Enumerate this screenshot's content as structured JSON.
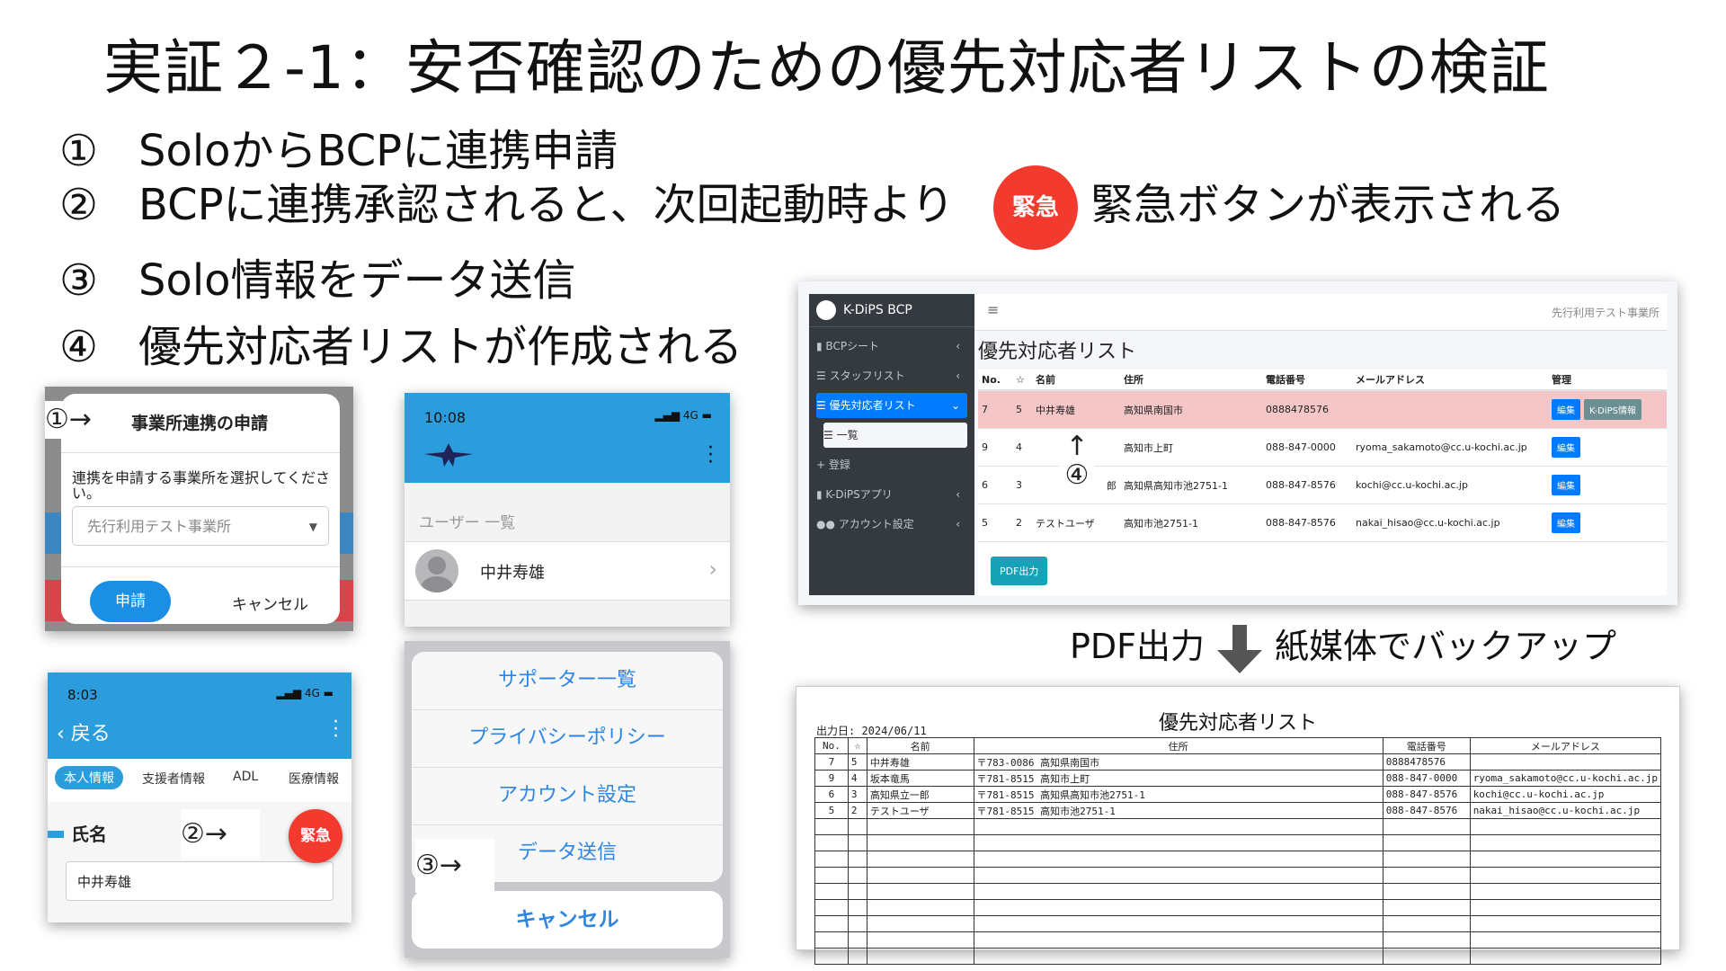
{
  "title": "実証２-1：安否確認のための優先対応者リストの検証",
  "steps": [
    {
      "num": "①",
      "text": "SoloからBCPに連携申請"
    },
    {
      "num": "②",
      "text": "BCPに連携承認されると、次回起動時より",
      "badge": "緊急",
      "after": "緊急ボタンが表示される"
    },
    {
      "num": "③",
      "text": "Solo情報をデータ送信"
    },
    {
      "num": "④",
      "text": "優先対応者リストが作成される"
    }
  ],
  "panel1": {
    "tag": "①→",
    "header": "事業所連携の申請",
    "message": "連携を申請する事業所を選択してください。",
    "select_value": "先行利用テスト事業所",
    "apply": "申請",
    "cancel": "キャンセル"
  },
  "panel2": {
    "time": "10:08",
    "signal": "4G",
    "section": "ユーザー 一覧",
    "user": "中井寿雄"
  },
  "panel3": {
    "time": "8:03",
    "signal": "4G",
    "back": "戻る",
    "tabs": [
      "本人情報",
      "支援者情報",
      "ADL",
      "医療情報"
    ],
    "field_label": "氏名",
    "field_value": "中井寿雄",
    "emergency": "緊急",
    "tag": "②→"
  },
  "panel4": {
    "options": [
      "サポーター一覧",
      "プライバシーポリシー",
      "アカウント設定",
      "データ送信"
    ],
    "cancel": "キャンセル",
    "tag": "③→"
  },
  "webapp": {
    "brand": "K-DiPS BCP",
    "org": "先行利用テスト事業所",
    "menu": [
      {
        "label": "BCPシート",
        "arrow": "‹"
      },
      {
        "label": "スタッフリスト",
        "arrow": "‹"
      },
      {
        "label": "優先対応者リスト",
        "arrow": "⌄"
      },
      {
        "label": "一覧",
        "arrow": ""
      },
      {
        "label": "登録",
        "arrow": ""
      },
      {
        "label": "K-DiPSアプリ",
        "arrow": "‹"
      },
      {
        "label": "アカウント設定",
        "arrow": "‹"
      }
    ],
    "heading": "優先対応者リスト",
    "columns": [
      "No.",
      "☆",
      "名前",
      "住所",
      "電話番号",
      "メールアドレス",
      "管理"
    ],
    "rows": [
      {
        "no": "7",
        "star": "5",
        "name": "中井寿雄",
        "addr": "高知県南国市",
        "tel": "0888478576",
        "mail": ""
      },
      {
        "no": "9",
        "star": "4",
        "name": "",
        "addr": "高知市上町",
        "tel": "088-847-0000",
        "mail": "ryoma_sakamoto@cc.u-kochi.ac.jp"
      },
      {
        "no": "6",
        "star": "3",
        "name": "郎",
        "addr": "高知県高知市池2751-1",
        "tel": "088-847-8576",
        "mail": "kochi@cc.u-kochi.ac.jp"
      },
      {
        "no": "5",
        "star": "2",
        "name": "テストユーザ",
        "addr": "高知市池2751-1",
        "tel": "088-847-8576",
        "mail": "nakai_hisao@cc.u-kochi.ac.jp"
      }
    ],
    "edit": "編集",
    "kdips": "K-DiPS情報",
    "pdf_button": "PDF出力",
    "annotation": "↑\n④"
  },
  "pdf_line": {
    "left": "PDF出力",
    "right": "紙媒体でバックアップ"
  },
  "pdf": {
    "title": "優先対応者リスト",
    "date": "出力日: 2024/06/11",
    "columns": [
      "No.",
      "☆",
      "名前",
      "住所",
      "電話番号",
      "メールアドレス"
    ],
    "rows": [
      [
        "7",
        "5",
        "中井寿雄",
        "〒783-0086 高知県南国市",
        "0888478576",
        ""
      ],
      [
        "9",
        "4",
        "坂本竜馬",
        "〒781-8515 高知市上町",
        "088-847-0000",
        "ryoma_sakamoto@cc.u-kochi.ac.jp"
      ],
      [
        "6",
        "3",
        "高知県立一郎",
        "〒781-8515 高知県高知市池2751-1",
        "088-847-8576",
        "kochi@cc.u-kochi.ac.jp"
      ],
      [
        "5",
        "2",
        "テストユーザ",
        "〒781-8515 高知市池2751-1",
        "088-847-8576",
        "nakai_hisao@cc.u-kochi.ac.jp"
      ]
    ]
  }
}
